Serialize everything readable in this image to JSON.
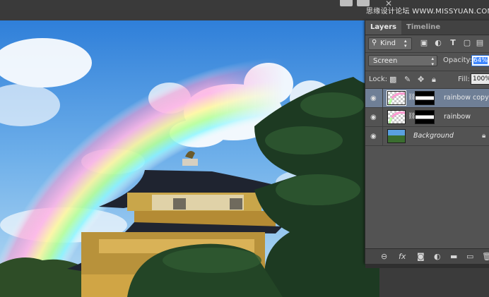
{
  "watermark": "思缘设计论坛 WWW.MISSYUAN.COM",
  "panel": {
    "tabs": [
      {
        "label": "Layers",
        "active": true
      },
      {
        "label": "Timeline",
        "active": false
      }
    ],
    "filter": {
      "kind_label": "Kind",
      "icons": [
        "image-filter-icon",
        "adjustment-filter-icon",
        "type-filter-icon",
        "shape-filter-icon",
        "smart-object-filter-icon"
      ]
    },
    "blend_mode": "Screen",
    "opacity_label": "Opacity:",
    "opacity_value": "64%",
    "lock_label": "Lock:",
    "fill_label": "Fill:",
    "fill_value": "100%",
    "layers": [
      {
        "name": "rainbow copy",
        "selected": true,
        "has_mask": true
      },
      {
        "name": "rainbow",
        "selected": false,
        "has_mask": true
      },
      {
        "name": "Background",
        "selected": false,
        "has_mask": false,
        "locked": true
      }
    ],
    "footer_icons": [
      "link-layers-icon",
      "fx-icon",
      "add-mask-icon",
      "adjustment-layer-icon",
      "new-group-icon",
      "new-layer-icon",
      "delete-layer-icon"
    ],
    "footer_fx_label": "fx"
  },
  "colors": {
    "panel_bg": "#535353",
    "selected_layer": "#6f7f96",
    "opacity_highlight": "#3f87ff"
  }
}
